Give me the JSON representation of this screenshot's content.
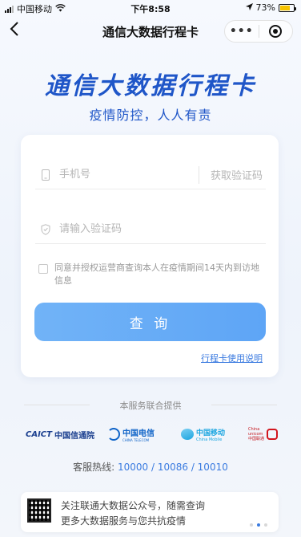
{
  "status_bar": {
    "carrier": "中国移动",
    "time": "下午8:58",
    "battery": "73%",
    "battery_level": 0.73
  },
  "nav": {
    "title": "通信大数据行程卡",
    "more_label": "•••"
  },
  "header": {
    "title": "通信大数据行程卡",
    "subtitle": "疫情防控，人人有责"
  },
  "form": {
    "phone_placeholder": "手机号",
    "get_code_label": "获取验证码",
    "code_placeholder": "请输入验证码",
    "agree_text": "同意并授权运营商查询本人在疫情期间14天内到访地信息",
    "query_label": "查 询",
    "help_link": "行程卡使用说明"
  },
  "providers": {
    "heading": "本服务联合提供",
    "caict_mark": "CAICT",
    "caict_name": "中国信通院",
    "telecom_cn": "中国电信",
    "telecom_en": "CHINA TELECOM",
    "mobile_cn": "中国移动",
    "mobile_en": "China Mobile",
    "unicom_text": "China unicom中国联通"
  },
  "hotline": {
    "label": "客服热线: ",
    "numbers": "10000 / 10086 / 10010"
  },
  "banner": {
    "line1": "关注联通大数据公众号，随需查询",
    "line2": "更多大数据服务与您共抗疫情"
  },
  "colors": {
    "brand": "#1f56c8",
    "accent": "#5ea5f6",
    "link": "#3b7be0"
  }
}
